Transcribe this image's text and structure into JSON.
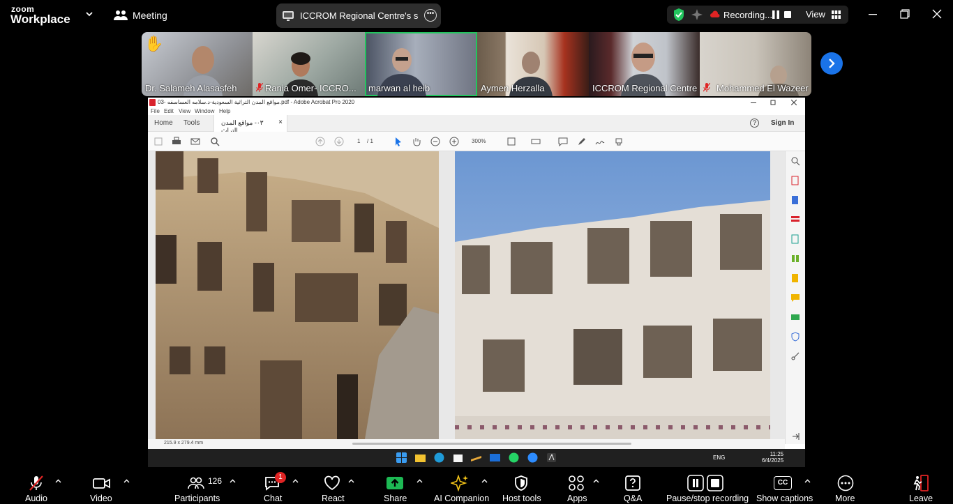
{
  "app": {
    "logo_top": "zoom",
    "logo_bottom": "Workplace",
    "meeting_label": "Meeting",
    "share_title": "ICCROM Regional Centre's scree",
    "recording_label": "Recording...",
    "view_label": "View"
  },
  "participants": [
    {
      "name": "Dr. Salameh Alasasfeh",
      "hand": "✋",
      "muted": false,
      "active": false
    },
    {
      "name": "Rania Omer- ICCRO...",
      "muted": true,
      "active": false
    },
    {
      "name": "marwan al heib",
      "muted": false,
      "active": true
    },
    {
      "name": "Aymen Herzalla",
      "muted": false,
      "active": false
    },
    {
      "name": "ICCROM Regional Centre",
      "muted": false,
      "active": false
    },
    {
      "name": "Mohammed El Wazeer",
      "muted": true,
      "active": false
    }
  ],
  "acrobat": {
    "title": "03- مواقع المدن التراثية السعودية-د.سلامه العساسفه.pdf - Adobe Acrobat Pro 2020",
    "menu": [
      "File",
      "Edit",
      "View",
      "Window",
      "Help"
    ],
    "tabs": {
      "home": "Home",
      "tools": "Tools",
      "doc": "٠٣- مواقع المدن التراث...",
      "close": "×"
    },
    "sign_in": "Sign In",
    "help": "?",
    "page_current": "1",
    "page_total": "/ 1",
    "zoom": "300%",
    "page_size": "215.9 x 279.4 mm"
  },
  "windows": {
    "lang": "ENG",
    "time": "11:25",
    "date": "6/4/2025"
  },
  "toolbar": {
    "audio": "Audio",
    "video": "Video",
    "participants": "Participants",
    "participants_count": "126",
    "chat": "Chat",
    "chat_badge": "1",
    "react": "React",
    "share": "Share",
    "ai": "AI Companion",
    "host_tools": "Host tools",
    "apps": "Apps",
    "qa": "Q&A",
    "pause_rec": "Pause/stop recording",
    "captions": "Show captions",
    "captions_icon": "CC",
    "more": "More",
    "leave": "Leave"
  },
  "colors": {
    "accent_blue": "#1a73e8",
    "active_green": "#22c55e",
    "share_green": "#1db954",
    "badge_red": "#e02424",
    "mute_red": "#e02424"
  }
}
